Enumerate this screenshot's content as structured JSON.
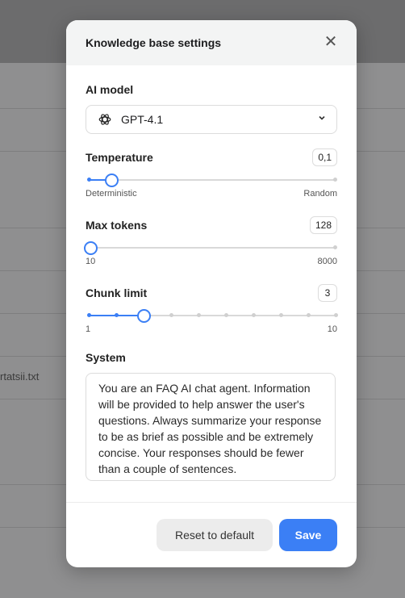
{
  "background": {
    "partial_filename": "rtatsii.txt"
  },
  "modal": {
    "title": "Knowledge base settings",
    "ai_model": {
      "label": "AI model",
      "selected": "GPT-4.1"
    },
    "temperature": {
      "label": "Temperature",
      "value": "0,1",
      "min_label": "Deterministic",
      "max_label": "Random",
      "fraction": 0.1
    },
    "max_tokens": {
      "label": "Max tokens",
      "value": "128",
      "min_label": "10",
      "max_label": "8000"
    },
    "chunk_limit": {
      "label": "Chunk limit",
      "value": "3",
      "min_label": "1",
      "max_label": "10"
    },
    "system": {
      "label": "System",
      "text": "You are an FAQ AI chat agent. Information will be provided to help answer the user's questions. Always summarize your response to be as brief as possible and be extremely concise. Your responses should be fewer than a couple of sentences."
    },
    "buttons": {
      "reset": "Reset to default",
      "save": "Save"
    }
  },
  "colors": {
    "accent": "#3b7ff5",
    "overlay": "#8f8f90"
  },
  "icons": {
    "model": "openai-logo-icon",
    "dropdown": "chevron-down-icon",
    "close": "close-icon"
  }
}
